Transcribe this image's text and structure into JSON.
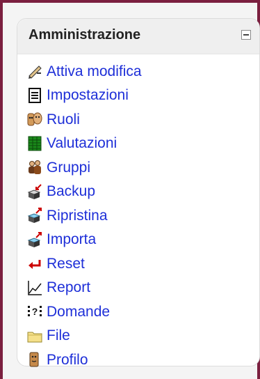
{
  "block": {
    "title": "Amministrazione",
    "items": [
      {
        "label": "Attiva modifica",
        "icon": "edit-pencil-icon"
      },
      {
        "label": "Impostazioni",
        "icon": "settings-document-icon"
      },
      {
        "label": "Ruoli",
        "icon": "roles-masks-icon"
      },
      {
        "label": "Valutazioni",
        "icon": "grades-spreadsheet-icon"
      },
      {
        "label": "Gruppi",
        "icon": "groups-people-icon"
      },
      {
        "label": "Backup",
        "icon": "backup-box-icon"
      },
      {
        "label": "Ripristina",
        "icon": "restore-box-icon"
      },
      {
        "label": "Importa",
        "icon": "import-box-icon"
      },
      {
        "label": "Reset",
        "icon": "reset-arrow-icon"
      },
      {
        "label": "Report",
        "icon": "report-chart-icon"
      },
      {
        "label": "Domande",
        "icon": "questions-icon"
      },
      {
        "label": "File",
        "icon": "folder-icon"
      },
      {
        "label": "Profilo",
        "icon": "profile-person-icon"
      }
    ]
  }
}
